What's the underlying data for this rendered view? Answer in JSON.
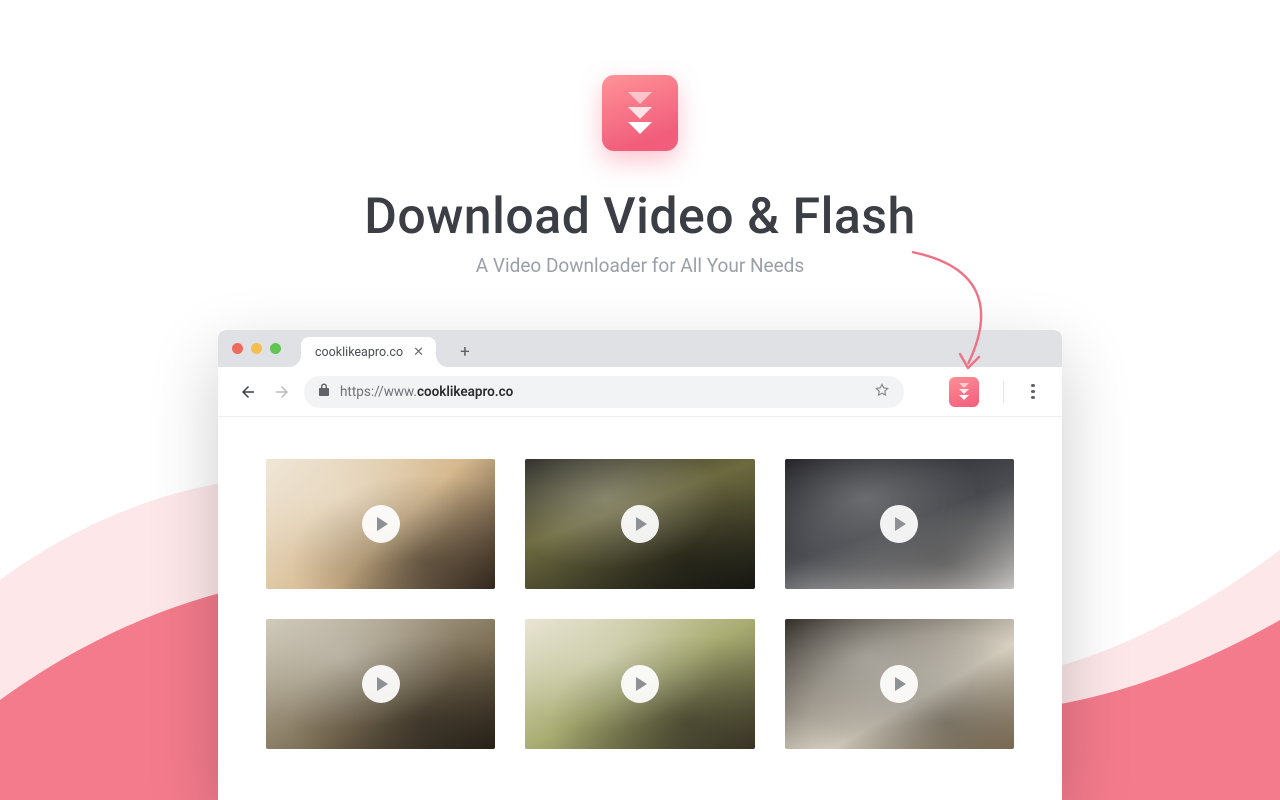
{
  "hero": {
    "title": "Download Video & Flash",
    "subtitle": "A Video Downloader for All Your Needs"
  },
  "browser": {
    "tab_title": "cooklikeapro.co",
    "url_prefix": "https://www.",
    "url_host": "cooklikeapro.co"
  }
}
